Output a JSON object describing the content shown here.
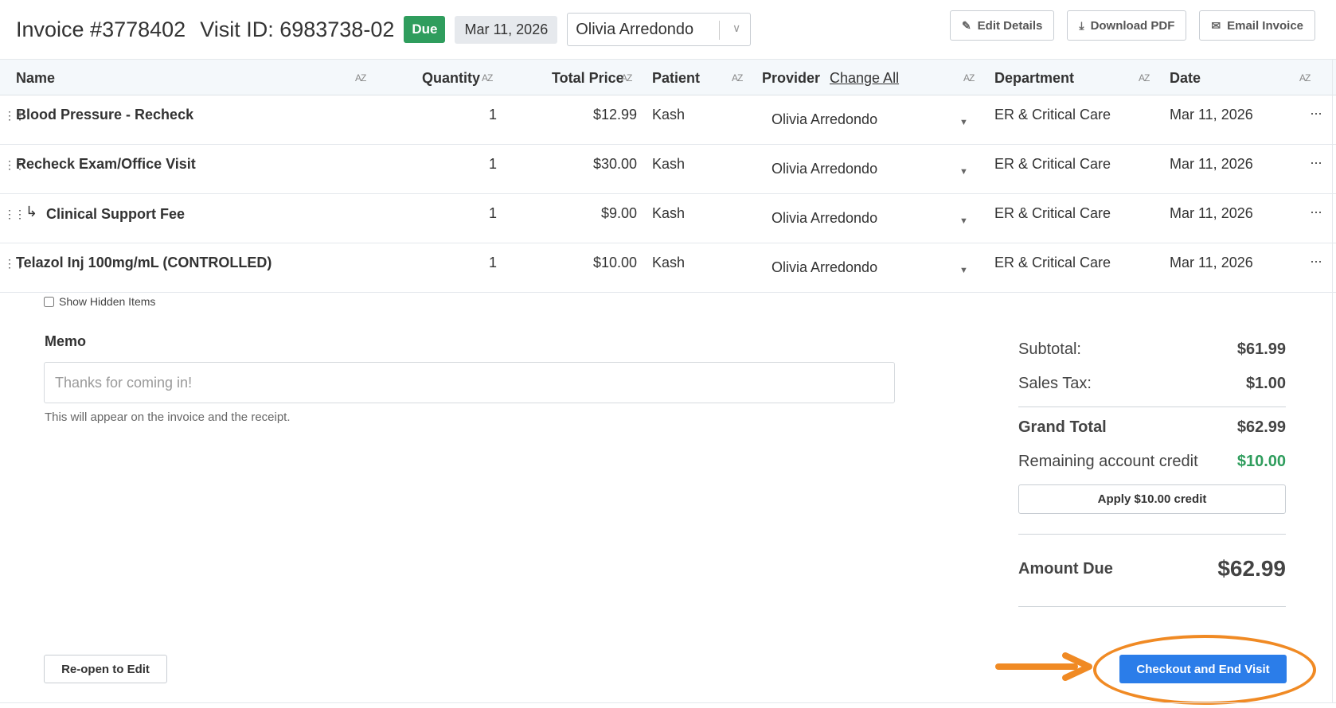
{
  "header": {
    "invoice_title": "Invoice #3778402",
    "visit_id": "Visit ID: 6983738-02",
    "status": "Due",
    "date": "Mar 11, 2026",
    "client": "Olivia Arredondo",
    "actions": {
      "edit": "Edit Details",
      "download": "Download PDF",
      "email": "Email Invoice"
    }
  },
  "table": {
    "columns": {
      "name": "Name",
      "quantity": "Quantity",
      "total_price": "Total Price",
      "patient": "Patient",
      "provider": "Provider",
      "change_all": "Change All",
      "department": "Department",
      "date": "Date"
    },
    "sort_icon": "AZ",
    "rows": [
      {
        "name": "Blood Pressure - Recheck",
        "quantity": "1",
        "price": "$12.99",
        "patient": "Kash",
        "provider": "Olivia Arredondo",
        "department": "ER & Critical Care",
        "date": "Mar 11, 2026"
      },
      {
        "name": "Recheck Exam/Office Visit",
        "quantity": "1",
        "price": "$30.00",
        "patient": "Kash",
        "provider": "Olivia Arredondo",
        "department": "ER & Critical Care",
        "date": "Mar 11, 2026"
      },
      {
        "name": "Clinical Support Fee",
        "quantity": "1",
        "price": "$9.00",
        "patient": "Kash",
        "provider": "Olivia Arredondo",
        "department": "ER & Critical Care",
        "date": "Mar 11, 2026"
      },
      {
        "name": "Telazol Inj 100mg/mL (CONTROLLED)",
        "quantity": "1",
        "price": "$10.00",
        "patient": "Kash",
        "provider": "Olivia Arredondo",
        "department": "ER & Critical Care",
        "date": "Mar 11, 2026"
      }
    ]
  },
  "show_hidden_label": "Show Hidden Items",
  "memo": {
    "label": "Memo",
    "placeholder": "Thanks for coming in!",
    "help": "This will appear on the invoice and the receipt."
  },
  "totals": {
    "subtotal_label": "Subtotal:",
    "subtotal": "$61.99",
    "tax_label": "Sales Tax:",
    "tax": "$1.00",
    "grand_label": "Grand Total",
    "grand": "$62.99",
    "credit_label": "Remaining account credit",
    "credit": "$10.00",
    "apply_label": "Apply $10.00 credit",
    "amount_due_label": "Amount Due",
    "amount_due": "$62.99"
  },
  "footer": {
    "reopen": "Re-open to Edit",
    "checkout": "Checkout and End Visit"
  },
  "colors": {
    "due_badge": "#2f9d5d",
    "credit": "#2f9d5d",
    "checkout": "#2b7de9",
    "highlight": "#f08a24"
  }
}
